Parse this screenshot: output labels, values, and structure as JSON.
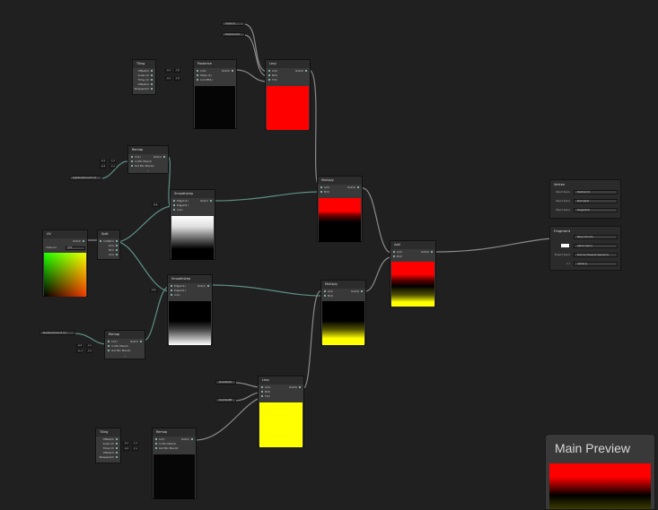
{
  "properties": {
    "bottom_color": "Color(1)",
    "top_color": "TopColor(4)",
    "lighten_amount": "LightenAmount (1)",
    "darken_amount": "DarkenAmount (1)",
    "gradient_start": "GradientA",
    "gradient_end": "GradientB"
  },
  "nodes": {
    "tiling": {
      "title": "Tiling",
      "ports": [
        "Offset(2)",
        "Scale (2)",
        "Tiling (2)",
        "Offset(2)",
        "Wrapped(2)"
      ]
    },
    "posterize": {
      "title": "Posterize",
      "inputs": [
        "In(4)",
        "Steps (4)",
        "Cut Off(1)"
      ],
      "output": "Out(4)",
      "vals": [
        "X 1",
        "Y 0",
        "X 1",
        "Y 0"
      ]
    },
    "lerp_top": {
      "title": "Lerp",
      "inputs": [
        "A(4)",
        "B(4)",
        "T(4)"
      ],
      "output": "Out(4)"
    },
    "remap_top": {
      "title": "Remap",
      "inputs": [
        "In(1)",
        "In Min Max(2)",
        "Out Min Max(2)"
      ],
      "output": "Out(1)",
      "vals": [
        "X 1",
        "Y 1",
        "X 0",
        "Y 1"
      ]
    },
    "smoothstep_top": {
      "title": "Smoothstep",
      "inputs": [
        "Edge1(1)",
        "Edge2(1)",
        "In(1)"
      ],
      "output": "Out(1)",
      "val": "X 0"
    },
    "uv": {
      "title": "UV",
      "output": "Out(4)",
      "channel_label": "Channel",
      "channel_value": "UV0"
    },
    "split": {
      "title": "Split",
      "input": "In(4)",
      "outputs": [
        "R(1)",
        "G(1)",
        "B(1)",
        "A(1)"
      ]
    },
    "smoothstep_bottom": {
      "title": "Smoothstep",
      "inputs": [
        "Edge1(1)",
        "Edge2(1)",
        "In(1)"
      ],
      "output": "Out(1)",
      "val": "X 0"
    },
    "remap_bottom": {
      "title": "Remap",
      "inputs": [
        "In(1)",
        "In Min Max(2)",
        "Out Min Max(2)"
      ],
      "output": "Out(1)",
      "vals": [
        "X 0",
        "Y 1",
        "X -1",
        "Y 1"
      ]
    },
    "multiply_top": {
      "title": "Multiply",
      "inputs": [
        "A(4)",
        "B(4)"
      ],
      "output": "Out(4)"
    },
    "multiply_bottom": {
      "title": "Multiply",
      "inputs": [
        "A(4)",
        "B(4)"
      ],
      "output": "Out(4)"
    },
    "add": {
      "title": "Add",
      "inputs": [
        "A(4)",
        "B(4)"
      ],
      "output": "Out(4)"
    },
    "lerp_bottom": {
      "title": "Lerp",
      "inputs": [
        "A(4)",
        "B(4)",
        "T(4)"
      ],
      "output": "Out(4)"
    },
    "tiling_bottom": {
      "title": "Tiling",
      "ports": [
        "Offset(2)",
        "Scale (2)",
        "Tiling (2)",
        "Offset(2)",
        "Wrapped(2)"
      ]
    },
    "remap_third": {
      "title": "Remap",
      "inputs": [
        "In(1)",
        "In Min Max(2)",
        "Out Min Max(2)"
      ],
      "output": "Out(1)",
      "vals": [
        "X 1",
        "Y 1",
        "X 0",
        "Y 1"
      ]
    }
  },
  "master": {
    "vertex": {
      "title": "Vertex",
      "slots": [
        {
          "label": "Object Space",
          "name": "Position(3)"
        },
        {
          "label": "Object Space",
          "name": "Normal(3)"
        },
        {
          "label": "Object Space",
          "name": "Tangent(3)"
        }
      ]
    },
    "fragment": {
      "title": "Fragment",
      "slots": [
        {
          "label": "",
          "name": "Base Color(3)"
        },
        {
          "label": "",
          "name": "Alpha Clip(1)"
        },
        {
          "label": "Tangent Space",
          "name": "Normal (Tangent Space)(3)"
        },
        {
          "label": "X 1",
          "name": "Alpha(1)"
        }
      ]
    }
  },
  "main_preview": {
    "title": "Main Preview"
  },
  "colors": {
    "wire_float": "#84b6b0",
    "wire_vector": "#b4a8c8",
    "canvas": "#202020",
    "node": "#393939"
  }
}
